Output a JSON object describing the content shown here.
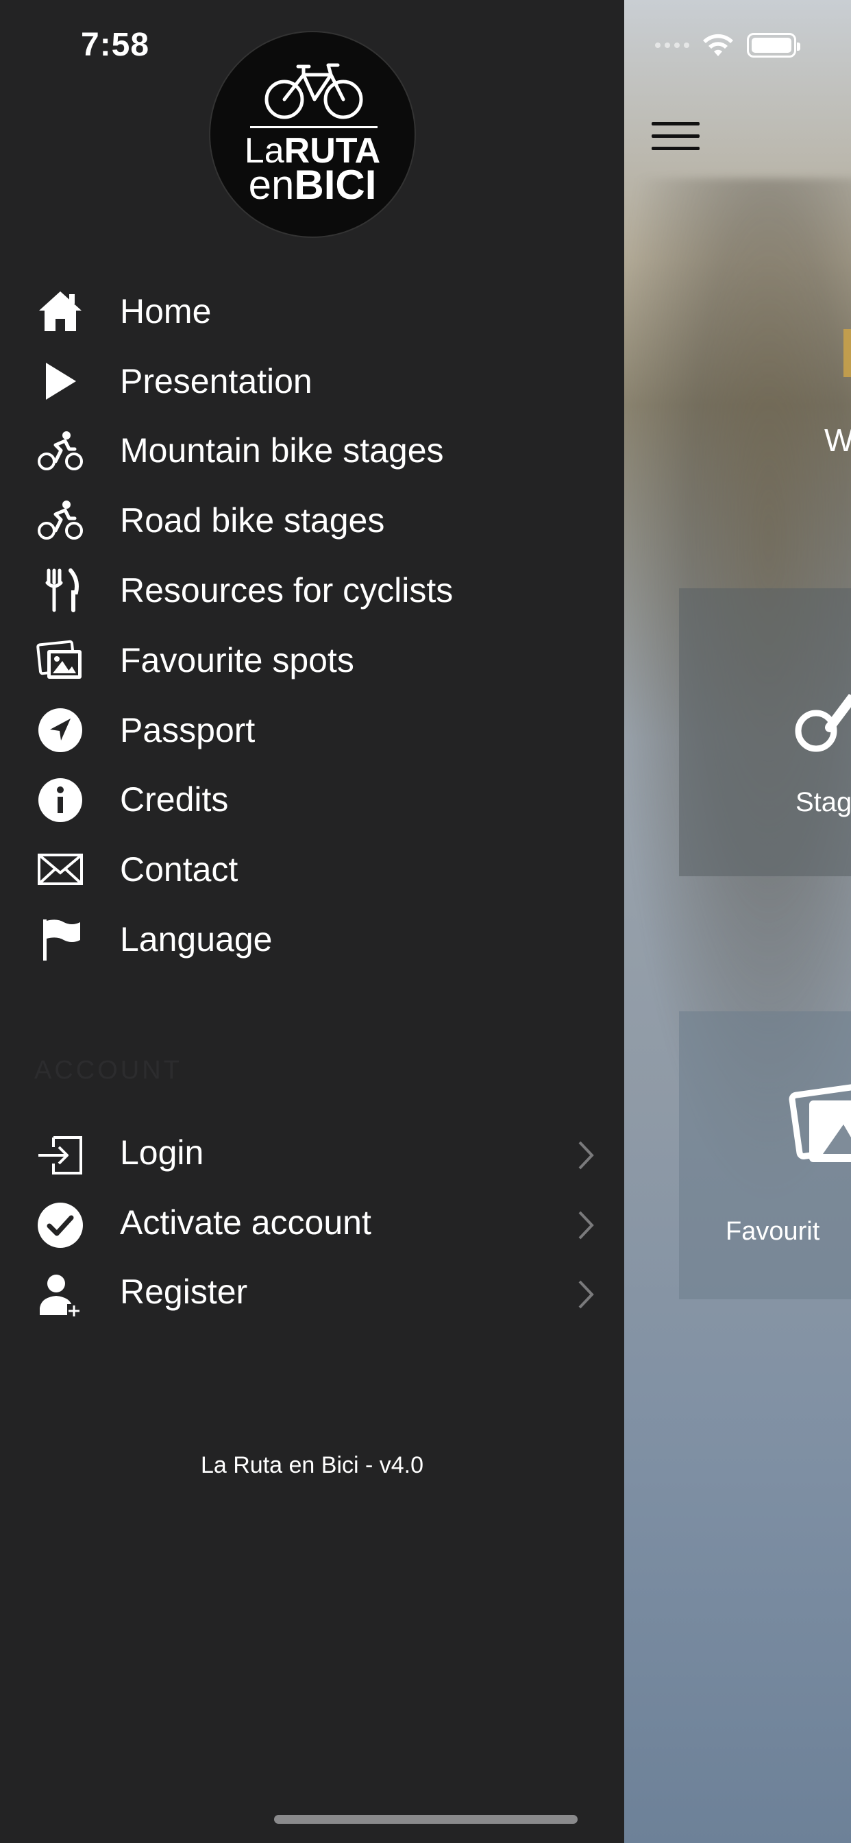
{
  "status_bar": {
    "time": "7:58"
  },
  "logo": {
    "line1_thin": "La",
    "line1_bold": "RUTA",
    "line2_thin": "en",
    "line2_bold": "BICI"
  },
  "menu": [
    {
      "label": "Home",
      "icon": "home-icon"
    },
    {
      "label": "Presentation",
      "icon": "play-icon"
    },
    {
      "label": "Mountain bike stages",
      "icon": "cyclist-icon"
    },
    {
      "label": "Road bike stages",
      "icon": "cyclist-icon"
    },
    {
      "label": "Resources for cyclists",
      "icon": "utensils-icon"
    },
    {
      "label": "Favourite spots",
      "icon": "photos-icon"
    },
    {
      "label": "Passport",
      "icon": "location-arrow-icon"
    },
    {
      "label": "Credits",
      "icon": "info-icon"
    },
    {
      "label": "Contact",
      "icon": "envelope-icon"
    },
    {
      "label": "Language",
      "icon": "flag-icon"
    }
  ],
  "account": {
    "section_title": "ACCOUNT",
    "items": [
      {
        "label": "Login",
        "icon": "login-icon"
      },
      {
        "label": "Activate account",
        "icon": "check-circle-icon"
      },
      {
        "label": "Register",
        "icon": "add-user-icon"
      }
    ]
  },
  "footer": {
    "version": "La Ruta en Bici - v4.0"
  },
  "background_screen": {
    "subtitle_fragment": "W",
    "tiles": [
      {
        "label": "Stag"
      },
      {
        "label": "Favourit"
      }
    ]
  }
}
